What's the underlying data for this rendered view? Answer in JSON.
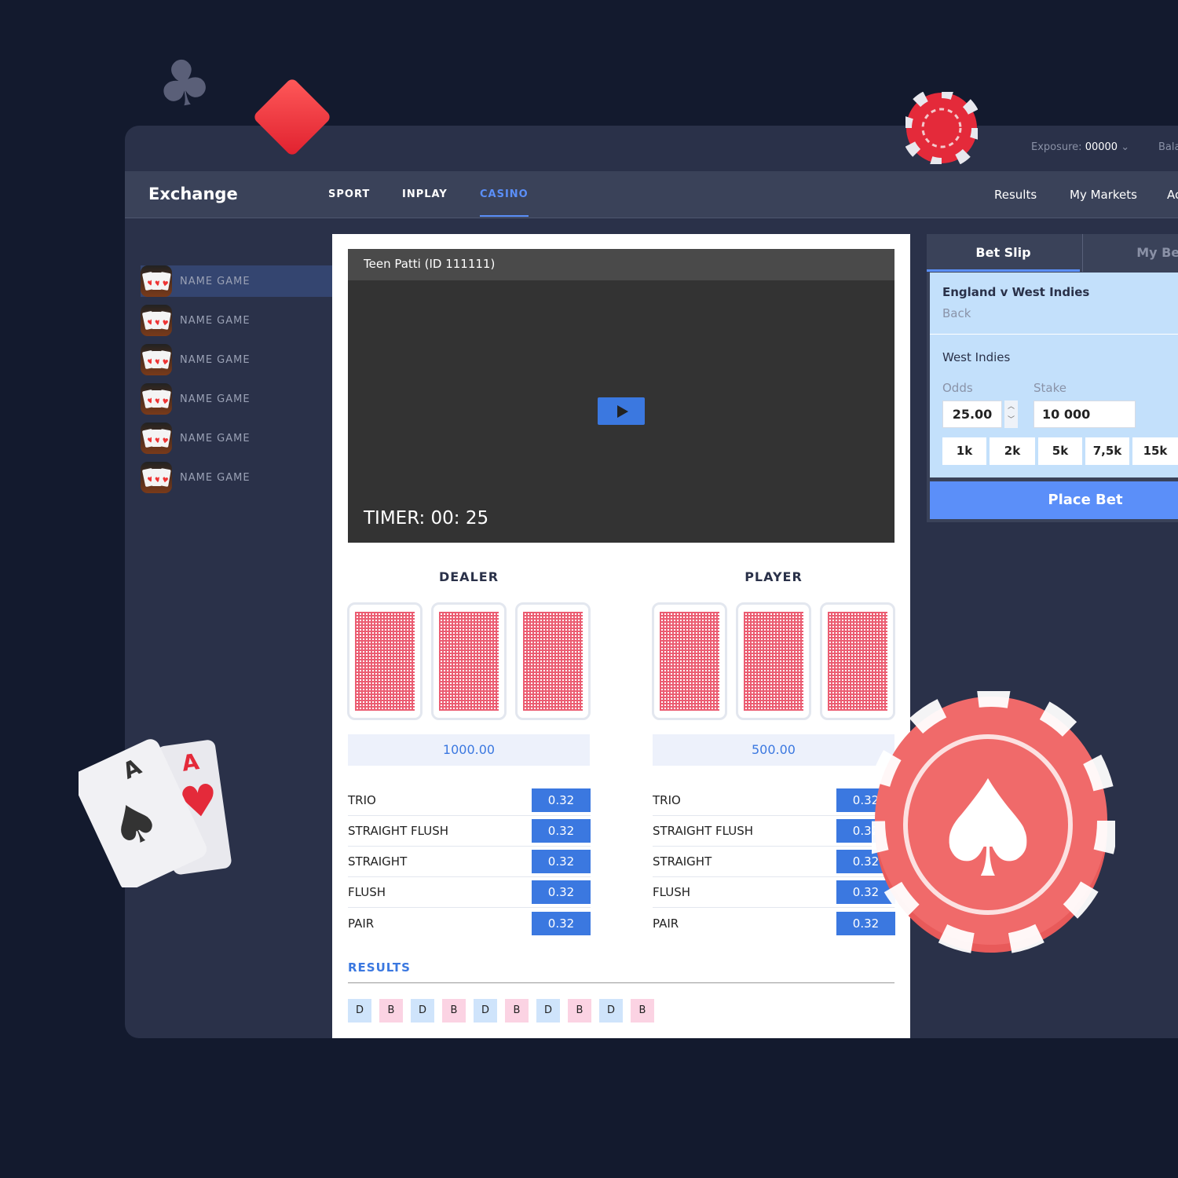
{
  "header": {
    "exposure_label": "Exposure:",
    "exposure_value": "00000",
    "balance_label": "Bala"
  },
  "nav": {
    "brand": "Exchange",
    "tabs": [
      "SPORT",
      "INPLAY",
      "CASINO"
    ],
    "active_tab": "CASINO",
    "right_links": [
      "Results",
      "My Markets",
      "Ac"
    ]
  },
  "sidebar": {
    "items": [
      "NAME GAME",
      "NAME GAME",
      "NAME GAME",
      "NAME GAME",
      "NAME GAME",
      "NAME GAME"
    ]
  },
  "game": {
    "title": "Teen Patti (ID 111111)",
    "timer": "TIMER: 00: 25",
    "dealer": {
      "label": "DEALER",
      "amount": "1000.00"
    },
    "player": {
      "label": "PLAYER",
      "amount": "500.00"
    },
    "bets": [
      {
        "name": "TRIO",
        "odds": "0.32"
      },
      {
        "name": "STRAIGHT FLUSH",
        "odds": "0.32"
      },
      {
        "name": "STRAIGHT",
        "odds": "0.32"
      },
      {
        "name": "FLUSH",
        "odds": "0.32"
      },
      {
        "name": "PAIR",
        "odds": "0.32"
      }
    ],
    "results_label": "RESULTS",
    "results": [
      "D",
      "B",
      "D",
      "B",
      "D",
      "B",
      "D",
      "B",
      "D",
      "B"
    ]
  },
  "betslip": {
    "tabs": [
      "Bet Slip",
      "My Bet"
    ],
    "match": "England v West Indies",
    "type": "Back",
    "selection": "West Indies",
    "odds_label": "Odds",
    "stake_label": "Stake",
    "odds": "25.00",
    "stake": "10 000",
    "chips": [
      "1k",
      "2k",
      "5k",
      "7,5k",
      "15k"
    ],
    "place": "Place Bet"
  },
  "colors": {
    "accent": "#5b8ff9",
    "odds": "#3b78e0",
    "result_d": "#cfe4fb",
    "result_b": "#fbd3e3"
  }
}
